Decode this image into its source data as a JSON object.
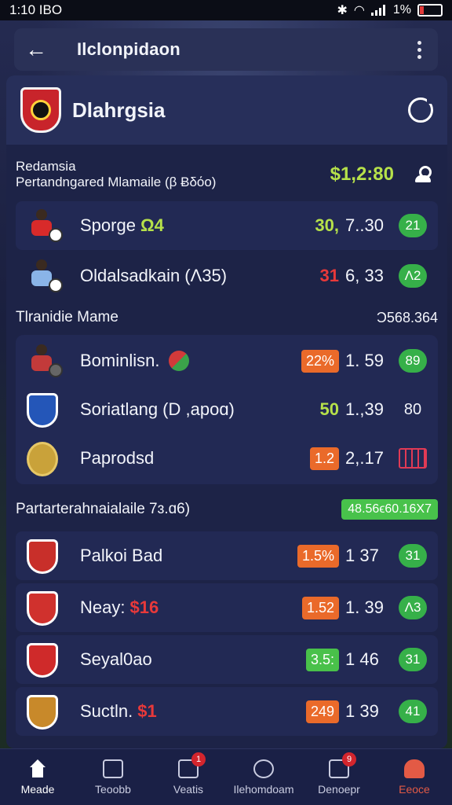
{
  "status": {
    "time": "1:10 ΙΒΟ",
    "battery": "1%"
  },
  "app_bar": {
    "title": "Ilclonpidaon"
  },
  "team": {
    "name": "Dlahrgsia"
  },
  "summary": {
    "line1": "Redamsia",
    "line2": "Pertandngared Mlamaile (β Ƀδόο)",
    "price": "$1,2:80"
  },
  "top_rows": [
    {
      "name": "Sporge",
      "tag": "Ω4",
      "val_a": "30,",
      "val_b": "7..30",
      "badge": "21"
    },
    {
      "name": "Oldalsadkain (Λ35)",
      "tag": "",
      "val_a": "31",
      "val_b": "6, 33",
      "badge": "Λ2"
    }
  ],
  "section1": {
    "title": "Tlranidie Mame",
    "right": "Ɔ568.364"
  },
  "section1_rows": [
    {
      "name": "Bominlisn.",
      "pill": "22%",
      "val_b": "1. 59",
      "badge": "89"
    },
    {
      "name": "Soriatlang (D ,apoɑ)",
      "val_a": "50",
      "val_b": "1.,39",
      "badge": "80"
    },
    {
      "name": "Paprodsd",
      "pill": "1.2",
      "val_b": "2,.17",
      "badge": ""
    }
  ],
  "section2": {
    "title": "Partarterahnaialaile 7ɜ.ɑ6)",
    "right": "48.56ϵ60.16X7"
  },
  "section2_rows": [
    {
      "name": "Palkoi Bad",
      "tag": "",
      "pill": "1.5%",
      "val_b": "1  37",
      "badge": "31"
    },
    {
      "name": "Neay:",
      "tag": "$16",
      "pill": "1.52",
      "val_b": "1. 39",
      "badge": "Λ3"
    },
    {
      "name": "Seyal0ao",
      "tag": "",
      "pill": "3.5:",
      "val_b": "1  46",
      "badge": "31"
    },
    {
      "name": "Suctln.",
      "tag": "$1",
      "pill": "249",
      "val_b": "1  39",
      "badge": "41"
    }
  ],
  "nav": [
    {
      "label": "Meade",
      "badge": ""
    },
    {
      "label": "Teoobb",
      "badge": ""
    },
    {
      "label": "Veatis",
      "badge": "1"
    },
    {
      "label": "Ilehomdoam",
      "badge": ""
    },
    {
      "label": "Denoepr",
      "badge": "9"
    },
    {
      "label": "Eeoce",
      "badge": ""
    }
  ],
  "colors": {
    "accent_green": "#b6e14a",
    "accent_red": "#e8393a",
    "pill_orange": "#ea6a2a",
    "badge_green": "#36b049",
    "panel": "#1d2347"
  }
}
